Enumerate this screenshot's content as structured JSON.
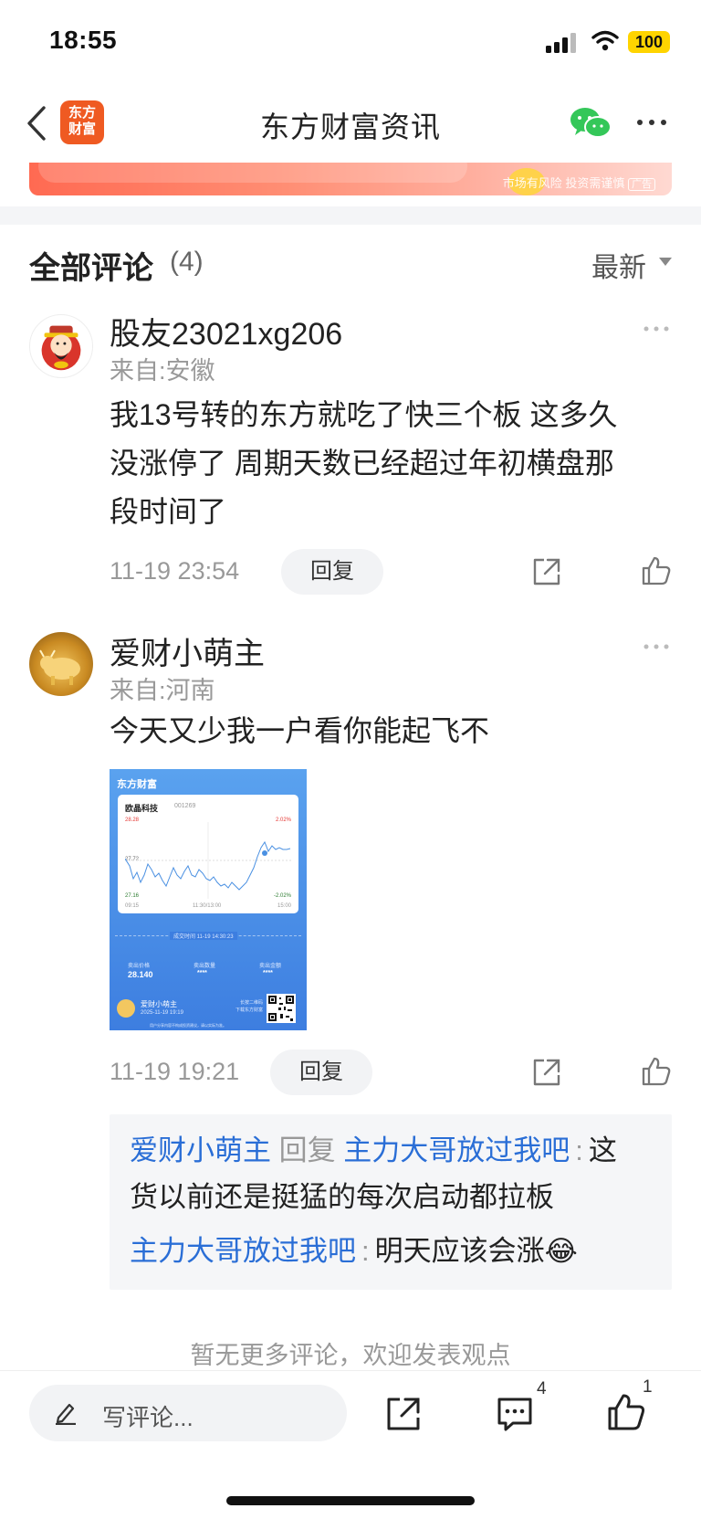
{
  "status_bar": {
    "time": "18:55",
    "battery": "100"
  },
  "nav": {
    "logo_text": "东方\n财富",
    "title": "东方财富资讯"
  },
  "ad": {
    "disclaimer": "市场有风险 投资需谨慎",
    "tag": "广告"
  },
  "comments_header": {
    "title": "全部评论",
    "count": "(4)",
    "sort_label": "最新"
  },
  "comments": [
    {
      "username": "股友23021xg206",
      "location": "来自:安徽",
      "text_lines": [
        "我13号转的东方就吃了快三个板 这多久",
        "没涨停了 周期天数已经超过年初横盘那",
        "段时间了"
      ],
      "timestamp": "11-19 23:54",
      "reply_label": "回复"
    },
    {
      "username": "爱财小萌主",
      "location": "来自:河南",
      "text_lines": [
        "今天又少我一户看你能起飞不"
      ],
      "timestamp": "11-19 19:21",
      "reply_label": "回复",
      "attachment": {
        "brand": "东方财富",
        "stock_name": "欧晶科技",
        "stock_code": "001269",
        "price_high": "28.28",
        "price_mid": "27.72",
        "price_low": "27.16",
        "pct_high": "2.02%",
        "pct_low": "-2.02%",
        "time_start": "09:15",
        "time_mid": "11:30/13:00",
        "time_end": "15:00",
        "trade_time": "成交时间 11-19 14:30:23",
        "sell_price_label": "卖出价格",
        "sell_price": "28.140",
        "sell_qty_label": "卖出数量",
        "sell_qty": "****",
        "sell_amount_label": "卖出金额",
        "sell_amount": "****",
        "user": "爱财小萌主",
        "user_date": "2025-11-19 19:19",
        "qr_text": "长按二维码\n下载东方财富",
        "footer": "用户分享内容不构成投资建议，请以实际为准。"
      },
      "replies": [
        {
          "from": "爱财小萌主",
          "verb": "回复",
          "to": "主力大哥放过我吧",
          "text_line1": "这",
          "text_line2": "货以前还是挺猛的每次启动都拉板"
        },
        {
          "from": "主力大哥放过我吧",
          "text": "明天应该会涨😂"
        }
      ]
    }
  ],
  "footer_note": "暂无更多评论，欢迎发表观点",
  "bottom_bar": {
    "input_placeholder": "写评论...",
    "comment_count": "4",
    "like_count": "1"
  },
  "colors": {
    "accent_link": "#2a6ed6",
    "logo_bg": "#ef5a22",
    "wechat": "#34c759"
  }
}
